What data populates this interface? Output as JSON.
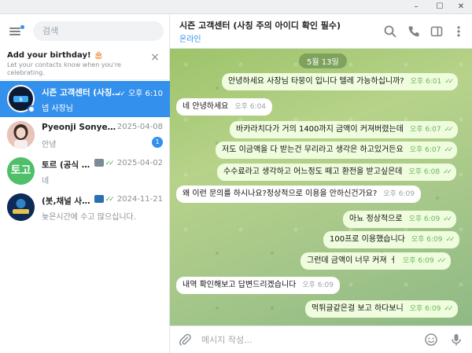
{
  "window": {
    "controls": [
      "–",
      "☐",
      "✕"
    ]
  },
  "sidebar": {
    "search_placeholder": "검색",
    "birthday": {
      "title": "Add your birthday! 🎂",
      "subtitle": "Let your contacts know when you're celebrating."
    },
    "chats": [
      {
        "name": "시즌 고객센터 (사칭...",
        "time": "오후 6:10",
        "preview": "넵 사장님",
        "status": "read",
        "active": true,
        "avatar_text": "S",
        "avatar_color": "#1b2a4a"
      },
      {
        "name": "Pyeonji Sonyeoui",
        "time": "2025-04-08",
        "preview": "안녕",
        "unread": "1",
        "avatar_text": "",
        "avatar_color": "#c98f88"
      },
      {
        "name": "토르 (공식 고...",
        "time": "2025-04-02",
        "preview": "네",
        "status": "read",
        "avatar_text": "토고",
        "avatar_color": "#4fbf6a"
      },
      {
        "name": "(봇,채널 사칭...",
        "time": "2024-11-21",
        "preview": "늦은시간에 수고 많으십니다.",
        "status": "read",
        "avatar_text": "",
        "avatar_color": "#0e2a58"
      }
    ]
  },
  "chat": {
    "title": "시즌 고객센터 (사칭 주의 아이디 확인 필수)",
    "status": "온라인",
    "date_divider": "5월 13일",
    "messages": [
      {
        "dir": "out",
        "text": "안녕하세요 사장님 타뭉이 입니다 텔레 가능하십니까?",
        "time": "오후 6:01",
        "read": true
      },
      {
        "dir": "in",
        "text": "네 안녕하세요",
        "time": "오후 6:04"
      },
      {
        "dir": "out",
        "text": "바카라치다가 거의 1400까지 금액이 커져버렸는데",
        "time": "오후 6:07",
        "read": true
      },
      {
        "dir": "out",
        "text": "저도 이금액을 다 받는건 무리라고 생각은 하고있거든요",
        "time": "오후 6:07",
        "read": true
      },
      {
        "dir": "out",
        "text": "수수료라고 생각하고 어느정도 떼고 환전을 받고싶은데",
        "time": "오후 6:08",
        "read": true
      },
      {
        "dir": "in",
        "text": "왜 이런 문의를 하시나요?정상적으로 이용을 안하신건가요?",
        "time": "오후 6:09"
      },
      {
        "dir": "out",
        "text": "아뇨 정상적으로",
        "time": "오후 6:09",
        "read": true
      },
      {
        "dir": "out",
        "text": "100프로 이용했습니다",
        "time": "오후 6:09",
        "read": true
      },
      {
        "dir": "out",
        "text": "그런데 금액이 너무 커져 ㅓ",
        "time": "오후 6:09",
        "read": true
      },
      {
        "dir": "in",
        "text": "내역 확인해보고 답변드리겠습니다",
        "time": "오후 6:09"
      },
      {
        "dir": "out",
        "text": "먹튀글같은걸 보고 하다보니",
        "time": "오후 6:09",
        "read": true
      }
    ],
    "composer_placeholder": "메시지 작성..."
  },
  "colors": {
    "accent": "#3390ec",
    "outgoing_bubble": "#effdde",
    "incoming_bubble": "#ffffff",
    "read_tick": "#4fae4e"
  }
}
